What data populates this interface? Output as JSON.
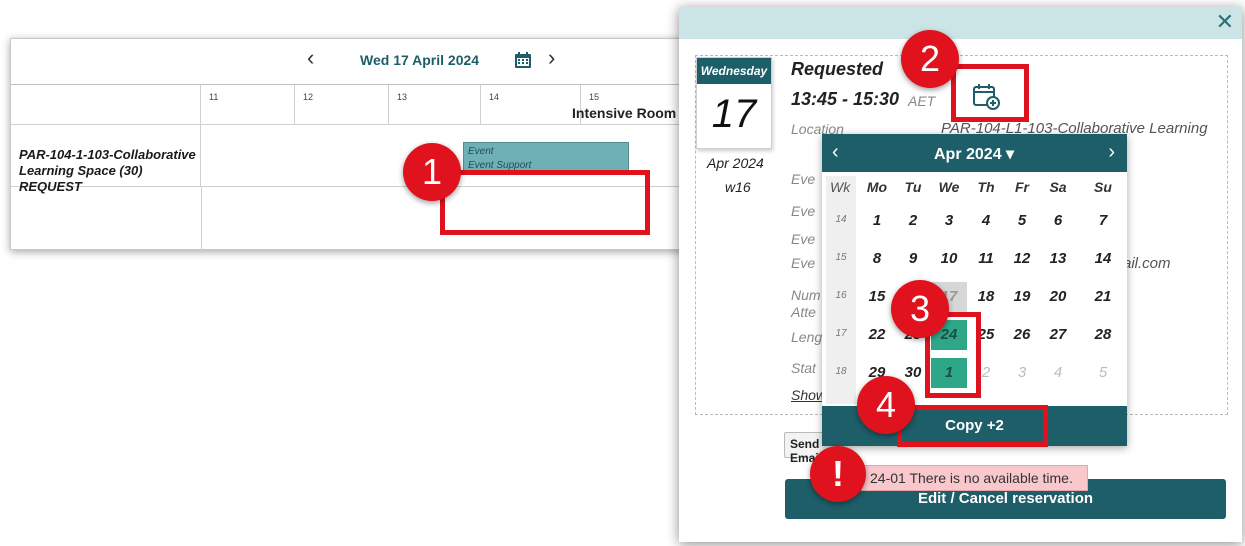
{
  "schedule": {
    "date_title": "Wed 17 April 2024",
    "hours": [
      "11",
      "12",
      "13",
      "14",
      "15"
    ],
    "room_title": "Intensive Room",
    "room_label": "PAR-104-1-103-Collaborative Learning Space (30) REQUEST",
    "event_line1": "Event",
    "event_line2": "Event Support"
  },
  "dialog": {
    "day_name": "Wednesday",
    "day_number": "17",
    "month_year": "Apr 2024",
    "week": "w16",
    "status": "Requested",
    "time_range": "13:45 - 15:30",
    "timezone": "AET",
    "location_label": "Location",
    "location_value": "PAR-104-L1-103-Collaborative Learning",
    "field_labels": [
      "Eve",
      "Eve",
      "Eve",
      "Eve",
      "Num",
      "Atte",
      "Leng",
      "Stat"
    ],
    "email_suffix": "ail.com",
    "show_link": "Show",
    "send_button": "Send Email",
    "error_text": "24-01 There is no available time.",
    "edit_button": "Edit / Cancel reservation"
  },
  "picker": {
    "title": "Apr  2024",
    "wk_label": "Wk",
    "weekdays": [
      "Mo",
      "Tu",
      "We",
      "Th",
      "Fr",
      "Sa",
      "Su"
    ],
    "week_numbers": [
      "14",
      "15",
      "16",
      "17",
      "18"
    ],
    "weeks": [
      [
        "1",
        "2",
        "3",
        "4",
        "5",
        "6",
        "7"
      ],
      [
        "8",
        "9",
        "10",
        "11",
        "12",
        "13",
        "14"
      ],
      [
        "15",
        "16",
        "17",
        "18",
        "19",
        "20",
        "21"
      ],
      [
        "22",
        "23",
        "24",
        "25",
        "26",
        "27",
        "28"
      ],
      [
        "29",
        "30",
        "1",
        "2",
        "3",
        "4",
        "5"
      ]
    ],
    "copy_button": "Copy +2"
  },
  "annotations": {
    "step1": "1",
    "step2": "2",
    "step3": "3",
    "step4": "4",
    "alert": "!"
  },
  "colors": {
    "accent": "#1d5e68",
    "selected": "#2ea789",
    "highlight": "#e0121e",
    "error_bg": "#f8c8cc"
  }
}
